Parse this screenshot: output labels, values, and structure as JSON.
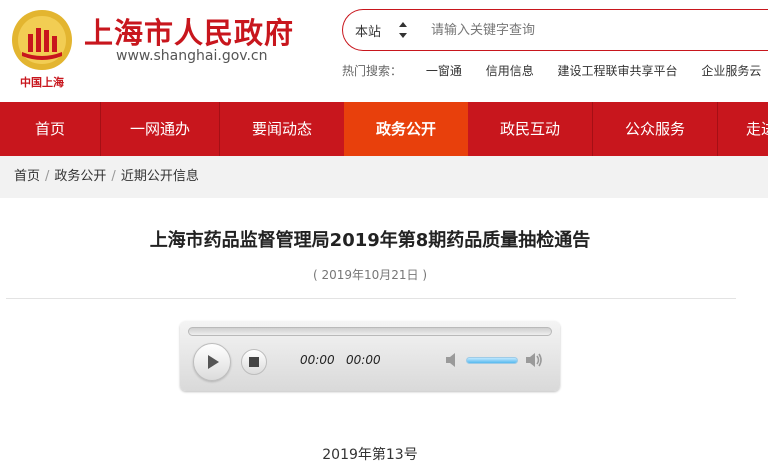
{
  "header": {
    "site_title": "上海市人民政府",
    "site_url": "www.shanghai.gov.cn",
    "logo_caption": "中国上海"
  },
  "search": {
    "scope": "本站",
    "placeholder": "请输入关键字查询"
  },
  "hot_search": {
    "label": "热门搜索：",
    "links": [
      "一窗通",
      "信用信息",
      "建设工程联审共享平台",
      "企业服务云"
    ]
  },
  "nav": {
    "items": [
      {
        "label": "首页",
        "active": false
      },
      {
        "label": "一网通办",
        "active": false
      },
      {
        "label": "要闻动态",
        "active": false
      },
      {
        "label": "政务公开",
        "active": true
      },
      {
        "label": "政民互动",
        "active": false
      },
      {
        "label": "公众服务",
        "active": false
      },
      {
        "label": "走进",
        "active": false
      }
    ]
  },
  "breadcrumb": [
    "首页",
    "政务公开",
    "近期公开信息"
  ],
  "article": {
    "title": "上海市药品监督管理局2019年第8期药品质量抽检通告",
    "date": "( 2019年10月21日 )",
    "doc_number": "2019年第13号"
  },
  "player": {
    "current_time": "00:00",
    "duration": "00:00",
    "volume": 0.85
  },
  "colors": {
    "brand_red": "#c8161d",
    "nav_active": "#e8400c"
  }
}
